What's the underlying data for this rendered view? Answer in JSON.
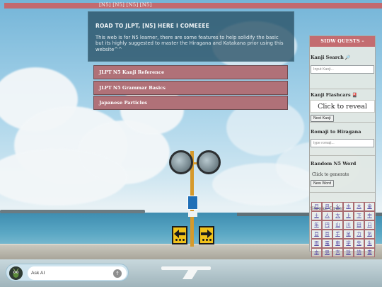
{
  "topbar": {
    "text": "[N5] [N5] [N5] [N5]"
  },
  "hero": {
    "title": "ROAD TO JLPT, [N5] HERE I COMEEEE",
    "body": "This web is for N5 learner, there are some features to help solidify the basic but its highly suggested to master the Hiragana and Katakana prior using this website^^"
  },
  "menu": {
    "items": [
      {
        "label": "JLPT N5 Kanji Reference"
      },
      {
        "label": "JLPT N5 Grammar Basics"
      },
      {
        "label": "Japanese Particles"
      }
    ]
  },
  "sidebar": {
    "header": "SIDW QUESTS –",
    "kanji_search": {
      "title": "Kanji Search",
      "icon": "🔎",
      "placeholder": "Input Kanji..."
    },
    "flashcards": {
      "title": "Kanji Flashcars",
      "icon": "🎴",
      "card_text": "Click to reveal",
      "button": "Next Kanji"
    },
    "romaji": {
      "title": "Romaji to Hiragana",
      "placeholder": "type romaji..."
    },
    "random_word": {
      "title": "Random N5 Word",
      "text": "Click to generate",
      "button": "New Word"
    },
    "stroke_order": {
      "title": "Stroke Order",
      "kanji": [
        "日",
        "月",
        "火",
        "水",
        "木",
        "金",
        "土",
        "人",
        "大",
        "上",
        "下",
        "中",
        "年",
        "円",
        "山",
        "川",
        "田",
        "口",
        "目",
        "耳",
        "手",
        "足",
        "力",
        "気",
        "雨",
        "電",
        "車",
        "学",
        "先",
        "生",
        "本",
        "見",
        "言",
        "話",
        "読",
        "書"
      ]
    }
  },
  "ask_ai": {
    "placeholder": "Ask AI",
    "send_icon": "↑"
  },
  "colors": {
    "accent": "#c26a6f",
    "menu_button": "#b07178",
    "hero_panel": "#285064"
  }
}
